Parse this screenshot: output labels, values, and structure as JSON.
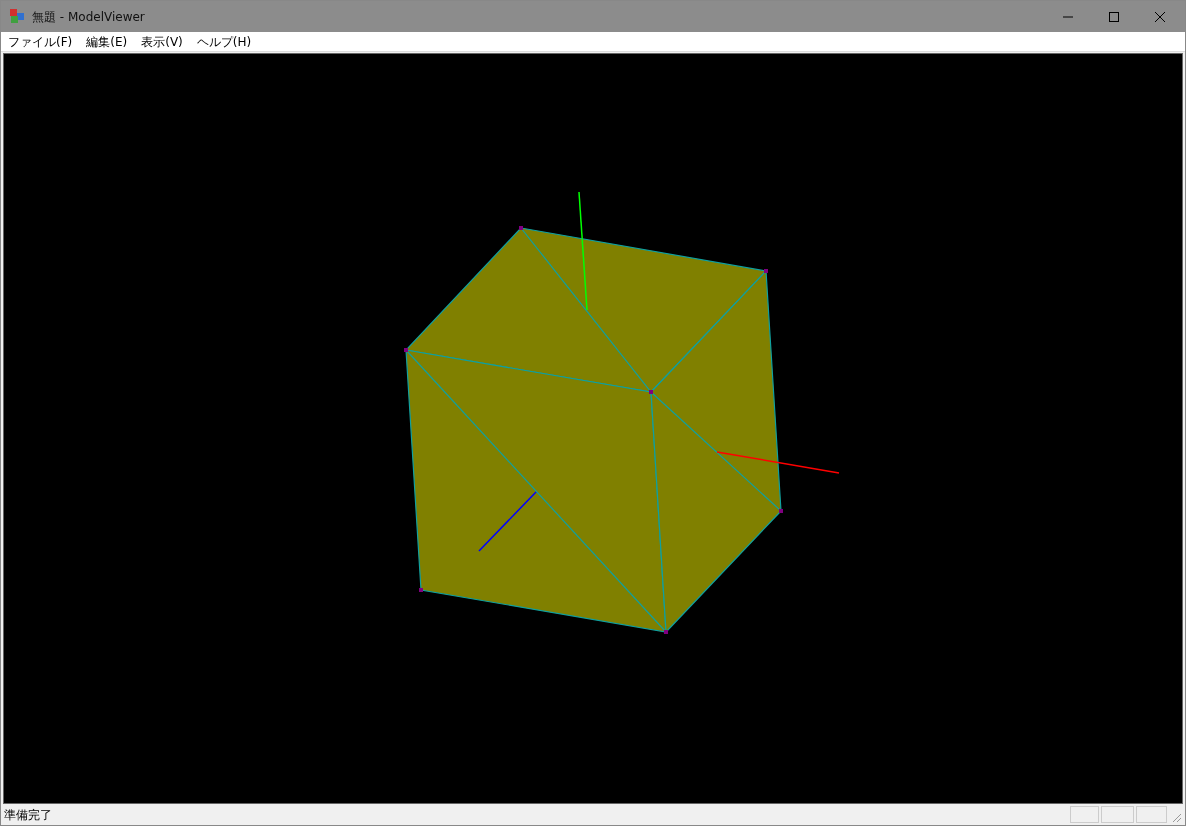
{
  "window": {
    "title": "無題 - ModelViewer"
  },
  "menu": [
    {
      "label": "ファイル(F)"
    },
    {
      "label": "編集(E)"
    },
    {
      "label": "表示(V)"
    },
    {
      "label": "ヘルプ(H)"
    }
  ],
  "status_bar": {
    "text": "準備完了"
  }
}
